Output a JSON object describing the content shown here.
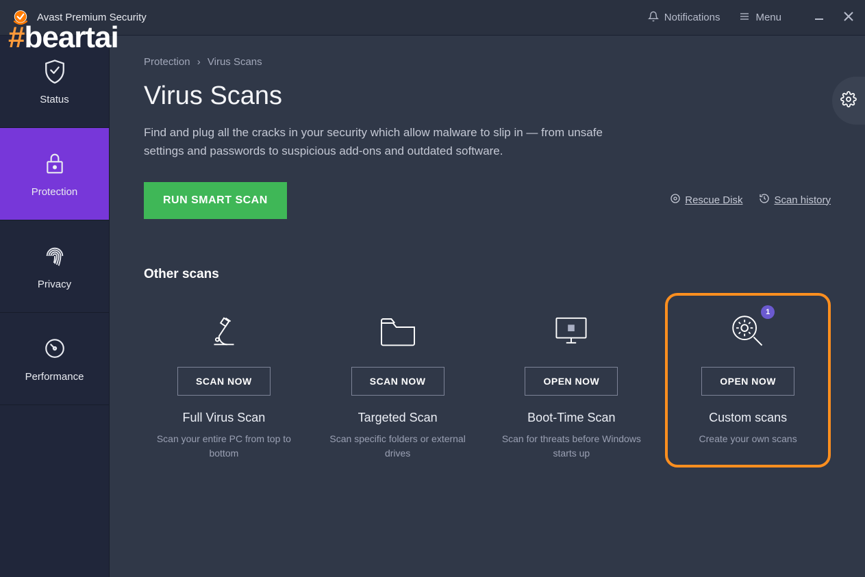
{
  "app": {
    "title": "Avast Premium Security"
  },
  "titlebar": {
    "notifications": "Notifications",
    "menu": "Menu"
  },
  "watermark": "beartai",
  "sidebar": {
    "items": [
      {
        "label": "Status"
      },
      {
        "label": "Protection"
      },
      {
        "label": "Privacy"
      },
      {
        "label": "Performance"
      }
    ]
  },
  "breadcrumb": {
    "parent": "Protection",
    "page": "Virus Scans"
  },
  "page": {
    "title": "Virus Scans",
    "description": "Find and plug all the cracks in your security which allow malware to slip in — from unsafe settings and passwords to suspicious add-ons and outdated software.",
    "primary_button": "RUN SMART SCAN"
  },
  "links": {
    "rescue_disk": "Rescue Disk",
    "scan_history": "Scan history"
  },
  "section": {
    "title": "Other scans"
  },
  "cards": [
    {
      "button": "SCAN NOW",
      "title": "Full Virus Scan",
      "desc": "Scan your entire PC from top to bottom"
    },
    {
      "button": "SCAN NOW",
      "title": "Targeted Scan",
      "desc": "Scan specific folders or external drives"
    },
    {
      "button": "OPEN NOW",
      "title": "Boot-Time Scan",
      "desc": "Scan for threats before Windows starts up"
    },
    {
      "button": "OPEN NOW",
      "title": "Custom scans",
      "desc": "Create your own scans",
      "badge": "1"
    }
  ]
}
